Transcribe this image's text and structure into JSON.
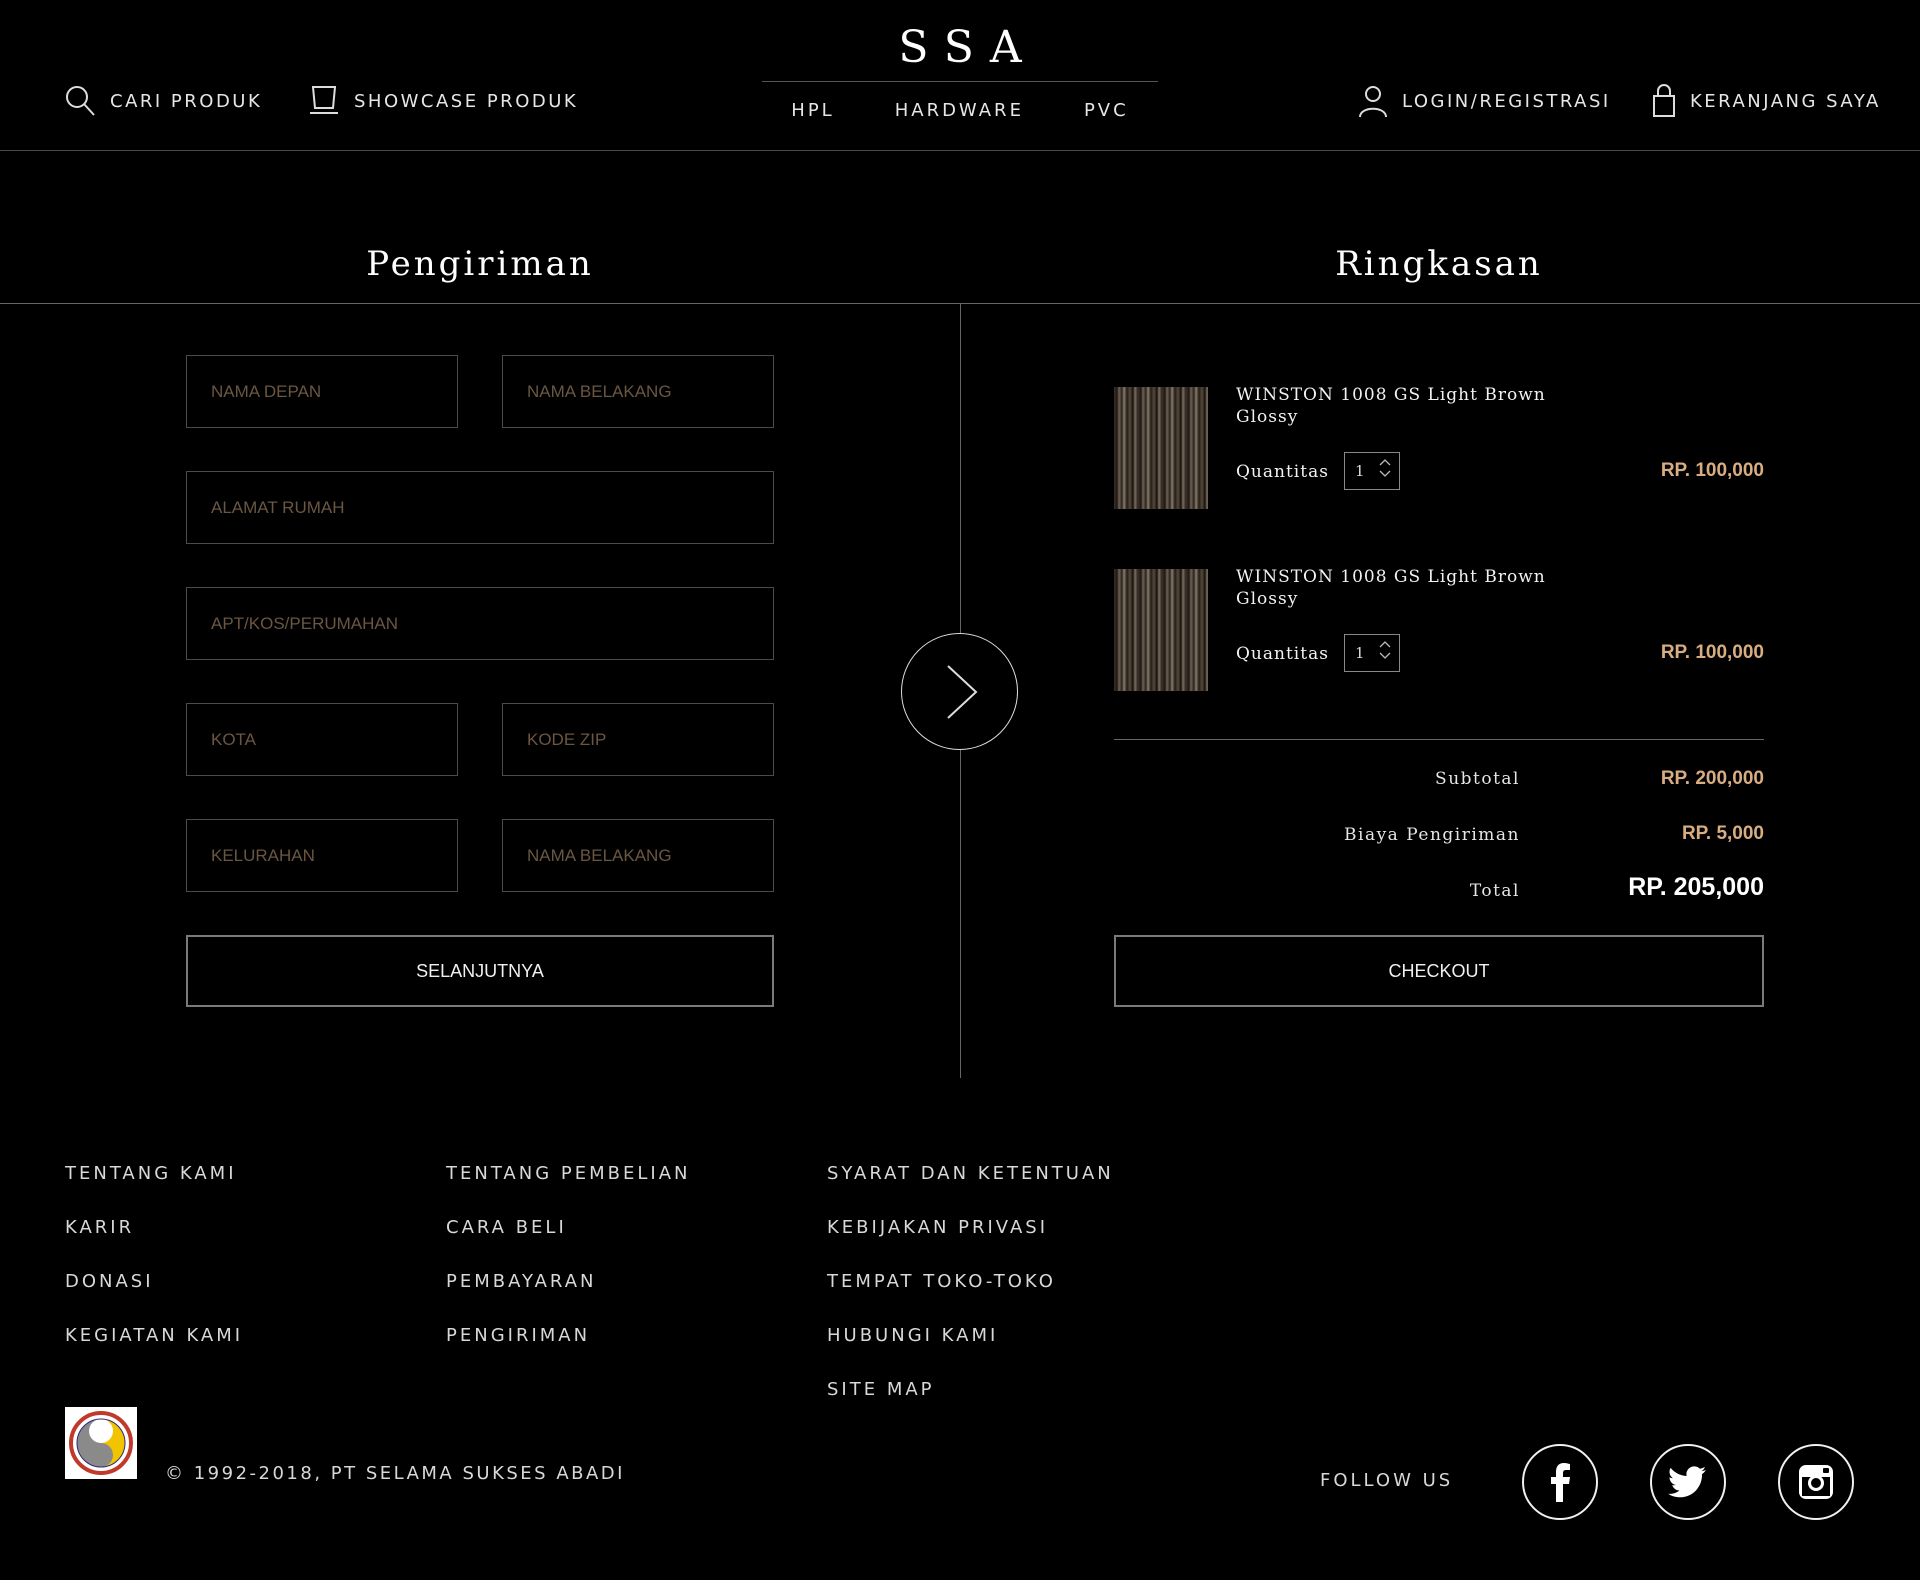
{
  "header": {
    "search_label": "CARI PRODUK",
    "showcase_label": "SHOWCASE PRODUK",
    "logo": "SSA",
    "categories": [
      "HPL",
      "HARDWARE",
      "PVC"
    ],
    "login_label": "LOGIN/REGISTRASI",
    "cart_label": "KERANJANG SAYA"
  },
  "shipping": {
    "title": "Pengiriman",
    "fields": {
      "first_name": "NAMA DEPAN",
      "last_name": "NAMA BELAKANG",
      "address": "ALAMAT RUMAH",
      "apt": "APT/KOS/PERUMAHAN",
      "city": "KOTA",
      "zip": "KODE ZIP",
      "kelurahan": "KELURAHAN",
      "last_name_2": "NAMA BELAKANG"
    },
    "next_button": "SELANJUTNYA"
  },
  "summary": {
    "title": "Ringkasan",
    "items": [
      {
        "name": "WINSTON 1008 GS Light Brown Glossy",
        "qty_label": "Quantitas",
        "qty": "1",
        "price": "RP. 100,000"
      },
      {
        "name": "WINSTON 1008 GS Light Brown Glossy",
        "qty_label": "Quantitas",
        "qty": "1",
        "price": "RP. 100,000"
      }
    ],
    "subtotal_label": "Subtotal",
    "subtotal": "RP. 200,000",
    "shipping_label": "Biaya Pengiriman",
    "shipping_cost": "RP. 5,000",
    "total_label": "Total",
    "total": "RP. 205,000",
    "checkout_button": "CHECKOUT"
  },
  "footer": {
    "col1": [
      "TENTANG KAMI",
      "KARIR",
      "DONASI",
      "KEGIATAN KAMI"
    ],
    "col2": [
      "TENTANG PEMBELIAN",
      "CARA BELI",
      "PEMBAYARAN",
      "PENGIRIMAN"
    ],
    "col3": [
      "SYARAT DAN KETENTUAN",
      "KEBIJAKAN PRIVASI",
      "TEMPAT TOKO-TOKO",
      "HUBUNGI KAMI",
      "SITE MAP"
    ],
    "copyright": "© 1992-2018, PT SELAMA SUKSES ABADI",
    "follow_label": "FOLLOW US",
    "social": [
      "facebook-icon",
      "twitter-icon",
      "instagram-icon"
    ]
  },
  "colors": {
    "background": "#000000",
    "price_accent": "#d9ad82",
    "placeholder": "#6a5642"
  }
}
